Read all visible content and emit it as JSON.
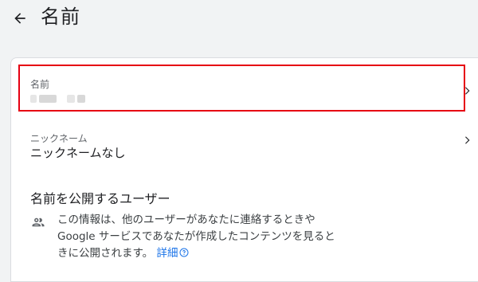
{
  "header": {
    "title": "名前"
  },
  "rows": [
    {
      "label": "名前",
      "value": ""
    },
    {
      "label": "ニックネーム",
      "value": "ニックネームなし"
    }
  ],
  "section": {
    "title": "名前を公開するユーザー",
    "info_line1": "この情報は、他のユーザーがあなたに連絡するときや",
    "info_line2": "Google サービスであなたが作成したコンテンツを見ると",
    "info_line3": "きに公開されます。",
    "link_label": "詳細"
  },
  "colors": {
    "highlight": "#e60012",
    "link": "#1a73e8"
  },
  "icons": {
    "back": "arrow-back-icon",
    "chevron": "chevron-right-icon",
    "people": "people-icon",
    "help": "help-circle-icon"
  }
}
